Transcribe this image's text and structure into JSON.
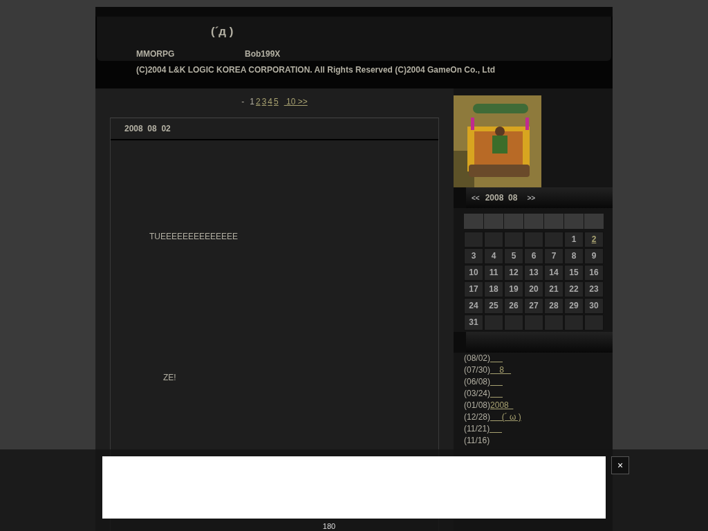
{
  "header": {
    "title": "(´д )",
    "subtitle_left": "MMORPG",
    "subtitle_right": "Bob199X",
    "copyright": "(C)2004 L&K LOGIC KOREA CORPORATION. All Rights Reserved (C)2004 GameOn Co., Ltd"
  },
  "pagination": {
    "prefix": "-",
    "pages": [
      {
        "label": "1",
        "selected": true
      },
      {
        "label": "2",
        "selected": false
      },
      {
        "label": "3",
        "selected": false
      },
      {
        "label": "4",
        "selected": false
      },
      {
        "label": "5",
        "selected": false
      }
    ],
    "next": " 10 >>"
  },
  "post": {
    "date": "2008  08  02",
    "lines": [
      {
        "text": "TUEEEEEEEEEEEEEE"
      },
      {
        "text": "ZE!"
      }
    ]
  },
  "calendar": {
    "prev": "<<",
    "month": "2008  08",
    "next": ">>",
    "weeks": [
      [
        {
          "kind": "blank"
        },
        {
          "kind": "blank"
        },
        {
          "kind": "blank"
        },
        {
          "kind": "blank"
        },
        {
          "kind": "blank"
        },
        {
          "day": "1",
          "has_post": false
        },
        {
          "day": "2",
          "has_post": true
        }
      ],
      [
        {
          "day": "3",
          "has_post": false
        },
        {
          "day": "4",
          "has_post": false
        },
        {
          "day": "5",
          "has_post": false
        },
        {
          "day": "6",
          "has_post": false
        },
        {
          "day": "7",
          "has_post": false
        },
        {
          "day": "8",
          "has_post": false
        },
        {
          "day": "9",
          "has_post": false
        }
      ],
      [
        {
          "day": "10",
          "has_post": false
        },
        {
          "day": "11",
          "has_post": false
        },
        {
          "day": "12",
          "has_post": false
        },
        {
          "day": "13",
          "has_post": false
        },
        {
          "day": "14",
          "has_post": false
        },
        {
          "day": "15",
          "has_post": false
        },
        {
          "day": "16",
          "has_post": false
        }
      ],
      [
        {
          "day": "17",
          "has_post": false
        },
        {
          "day": "18",
          "has_post": false
        },
        {
          "day": "19",
          "has_post": false
        },
        {
          "day": "20",
          "has_post": false
        },
        {
          "day": "21",
          "has_post": false
        },
        {
          "day": "22",
          "has_post": false
        },
        {
          "day": "23",
          "has_post": false
        }
      ],
      [
        {
          "day": "24",
          "has_post": false
        },
        {
          "day": "25",
          "has_post": false
        },
        {
          "day": "26",
          "has_post": false
        },
        {
          "day": "27",
          "has_post": false
        },
        {
          "day": "28",
          "has_post": false
        },
        {
          "day": "29",
          "has_post": false
        },
        {
          "day": "30",
          "has_post": false
        }
      ],
      [
        {
          "day": "31",
          "has_post": false
        },
        {
          "kind": "blank"
        },
        {
          "kind": "blank"
        },
        {
          "kind": "blank"
        },
        {
          "kind": "blank"
        },
        {
          "kind": "blank"
        },
        {
          "kind": "blank"
        }
      ]
    ]
  },
  "recent_posts": [
    {
      "date": "(08/02)",
      "kind": "blank_link"
    },
    {
      "date": "(07/30)",
      "title": "    8   "
    },
    {
      "date": "(06/08)",
      "kind": "blank_link"
    },
    {
      "date": "(03/24)",
      "kind": "blank_link"
    },
    {
      "date": "(01/08)",
      "title": "2008  "
    },
    {
      "date": "(12/28)",
      "title": "     (´ ω )"
    },
    {
      "date": "(11/21)",
      "kind": "blank_link"
    },
    {
      "date": "(11/16)"
    }
  ],
  "ad_bar": {
    "close": "×",
    "caption": "180"
  }
}
